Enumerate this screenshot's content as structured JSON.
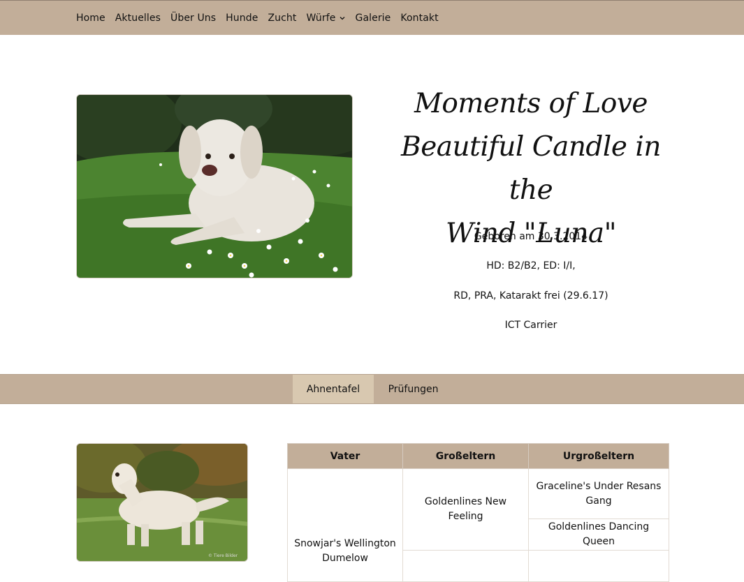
{
  "nav": {
    "items": [
      {
        "label": "Home"
      },
      {
        "label": "Aktuelles"
      },
      {
        "label": "Über Uns"
      },
      {
        "label": "Hunde"
      },
      {
        "label": "Zucht"
      },
      {
        "label": "Würfe",
        "has_dropdown": true
      },
      {
        "label": "Galerie"
      },
      {
        "label": "Kontakt"
      }
    ]
  },
  "hero": {
    "title_lines": [
      "Moments of Love",
      "Beautiful Candle in the",
      "Wind \"Luna\""
    ],
    "details": [
      "Geboren am 30.3.2014",
      "HD: B2/B2, ED: I/I,",
      "RD, PRA, Katarakt frei (29.6.17)",
      "ICT Carrier"
    ]
  },
  "tabs": [
    {
      "label": "Ahnentafel",
      "active": true
    },
    {
      "label": "Prüfungen",
      "active": false
    }
  ],
  "pedigree": {
    "headers": [
      "Vater",
      "Großeltern",
      "Urgroßeltern"
    ],
    "father": "Snowjar's Wellington Dumelow",
    "grandparent_1": "Goldenlines New Feeling",
    "great_grandparents": [
      "Graceline's Under Resans Gang",
      "Goldenlines Dancing Queen"
    ],
    "photo_watermark": "© Tiere Bilder"
  },
  "colors": {
    "nav_bg": "#c2ae99",
    "tab_active_bg": "#d8c8b0",
    "table_header_bg": "#c2ae99"
  }
}
